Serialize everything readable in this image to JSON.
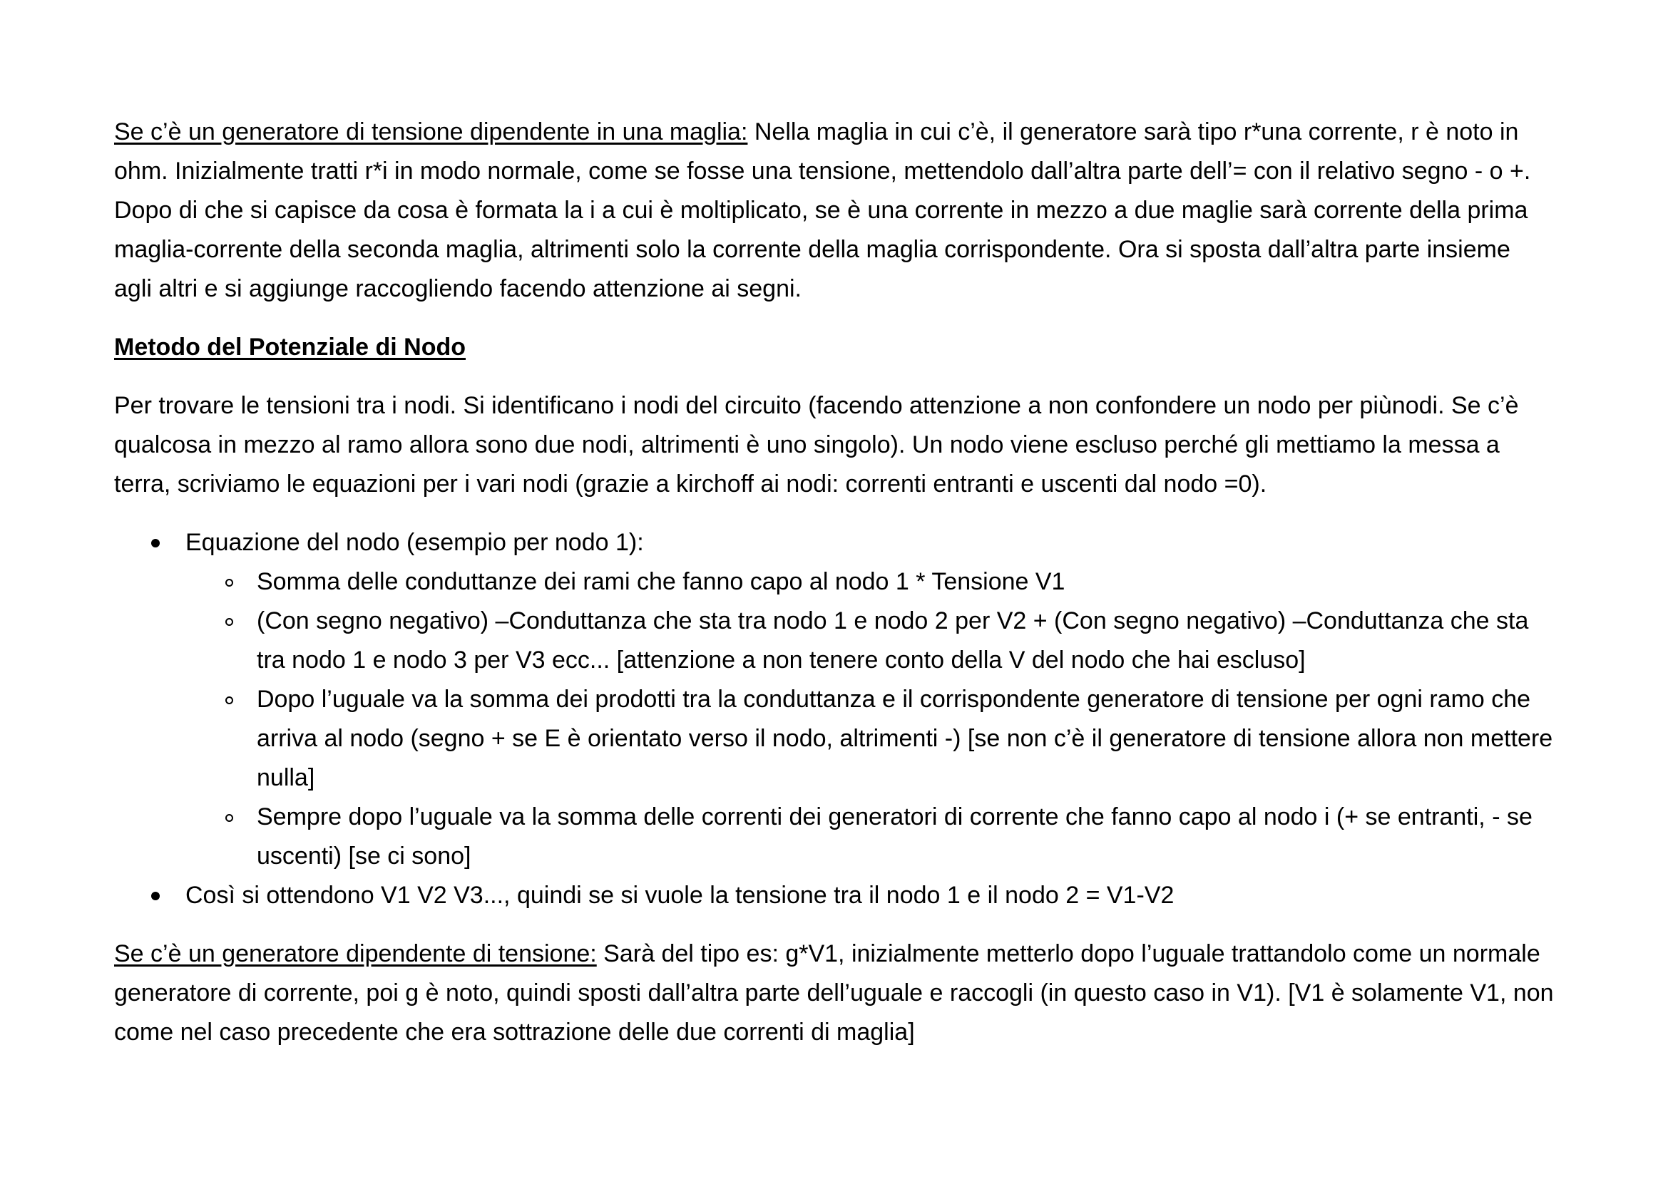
{
  "para1": {
    "heading": "Se c’è un generatore di tensione dipendente in una maglia:",
    "text": " Nella maglia in cui c’è, il generatore sarà tipo r*una corrente, r è noto in ohm. Inizialmente tratti r*i in modo normale, come se fosse una tensione, mettendolo dall’altra parte dell’= con il relativo segno - o +. Dopo di che si capisce da cosa è formata la i a cui è moltiplicato, se è una corrente in mezzo a due maglie sarà corrente della prima maglia-corrente della seconda maglia, altrimenti solo la corrente della maglia corrispondente. Ora si sposta dall’altra parte insieme agli altri e si aggiunge raccogliendo facendo attenzione ai segni."
  },
  "section_title": "Metodo del Potenziale di Nodo",
  "para2": "Per trovare le tensioni tra i nodi. Si identificano i nodi del circuito (facendo attenzione a non confondere un nodo per piùnodi. Se c’è qualcosa in mezzo al ramo allora sono due nodi, altrimenti è uno singolo). Un nodo viene escluso perché gli mettiamo la messa a terra, scriviamo le equazioni per i vari nodi (grazie a kirchoff ai nodi: correnti entranti e uscenti dal nodo =0).",
  "list": {
    "item1": "Equazione del nodo (esempio per nodo 1):",
    "subitems": [
      "Somma delle conduttanze dei rami che fanno capo al nodo 1 * Tensione V1",
      "(Con segno negativo) –Conduttanza che sta tra nodo 1 e nodo 2 per V2 + (Con segno negativo) –Conduttanza che sta tra nodo 1 e nodo 3 per V3 ecc...   [attenzione a non tenere conto della V del nodo che hai escluso]",
      "Dopo l’uguale va la somma dei prodotti tra la conduttanza e il corrispondente generatore di tensione per ogni ramo che arriva al nodo (segno + se E è orientato verso il nodo, altrimenti -) [se non c’è il generatore di tensione allora non mettere nulla]",
      "Sempre dopo l’uguale va la somma delle correnti dei generatori di corrente che fanno capo al nodo i (+ se entranti, - se uscenti) [se ci sono]"
    ],
    "item2": "Così si ottendono V1 V2 V3..., quindi se si vuole la tensione tra il nodo 1 e il nodo 2 = V1-V2"
  },
  "para3": {
    "heading": "Se c’è un generatore dipendente di tensione:",
    "text": " Sarà del tipo es: g*V1, inizialmente metterlo dopo l’uguale trattandolo come un normale generatore di corrente, poi g è noto, quindi sposti dall’altra parte dell’uguale e raccogli (in questo caso in V1). [V1 è solamente V1, non come nel caso precedente che era sottrazione delle due correnti di maglia]"
  }
}
